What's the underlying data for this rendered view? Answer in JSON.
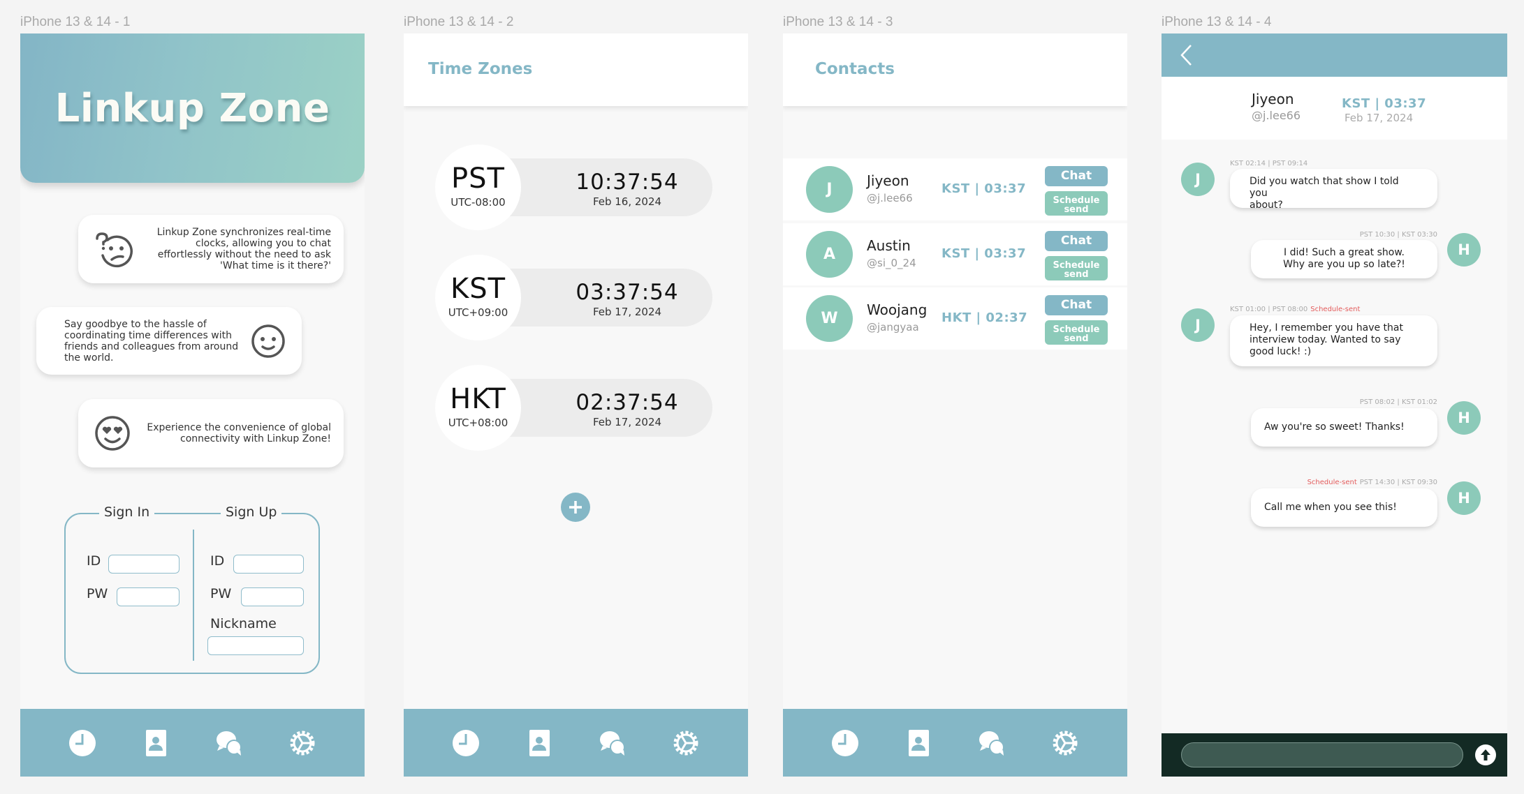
{
  "frames": [
    {
      "label": "iPhone 13 & 14 - 1"
    },
    {
      "label": "iPhone 13 & 14 - 2"
    },
    {
      "label": "iPhone 13 & 14 - 3"
    },
    {
      "label": "iPhone 13 & 14 - 4"
    }
  ],
  "nav": {
    "items": [
      {
        "icon": "clock-icon",
        "label": "Time Zones"
      },
      {
        "icon": "contact-book-icon",
        "label": "Contacts"
      },
      {
        "icon": "chat-bubbles-icon",
        "label": "Chats"
      },
      {
        "icon": "gear-icon",
        "label": "Settings"
      }
    ],
    "color": "#84b7c6"
  },
  "welcome": {
    "app_title": "Linkup Zone",
    "cards": [
      {
        "icon": "confused-face-icon",
        "text": "Linkup Zone synchronizes real-time clocks, allowing you to chat effortlessly without the need to ask 'What time is it there?'"
      },
      {
        "icon": "smiley-face-icon",
        "text": "Say goodbye to the hassle of coordinating time differences with friends and colleagues from around the world."
      },
      {
        "icon": "heart-eyes-face-icon",
        "text": "Experience the convenience of global connectivity with Linkup Zone!"
      }
    ],
    "sign_in": {
      "title": "Sign In",
      "id_label": "ID",
      "pw_label": "PW",
      "id_value": "",
      "pw_value": ""
    },
    "sign_up": {
      "title": "Sign Up",
      "id_label": "ID",
      "pw_label": "PW",
      "nickname_label": "Nickname",
      "id_value": "",
      "pw_value": "",
      "nickname_value": ""
    }
  },
  "timezones": {
    "title": "Time Zones",
    "clocks": [
      {
        "abbr": "PST",
        "offset": "UTC-08:00",
        "time": "10:37:54",
        "date": "Feb 16, 2024"
      },
      {
        "abbr": "KST",
        "offset": "UTC+09:00",
        "time": "03:37:54",
        "date": "Feb 17, 2024"
      },
      {
        "abbr": "HKT",
        "offset": "UTC+08:00",
        "time": "02:37:54",
        "date": "Feb 17, 2024"
      }
    ],
    "add_icon": "plus-icon"
  },
  "contacts": {
    "title": "Contacts",
    "chat_label": "Chat",
    "schedule_label_1": "Schedule",
    "schedule_label_2": "send",
    "list": [
      {
        "initial": "J",
        "name": "Jiyeon",
        "handle": "@j.lee66",
        "tz": "KST | 03:37"
      },
      {
        "initial": "A",
        "name": "Austin",
        "handle": "@si_0_24",
        "tz": "KST | 03:37"
      },
      {
        "initial": "W",
        "name": "Woojang",
        "handle": "@jangyaa",
        "tz": "HKT | 02:37"
      }
    ]
  },
  "chat": {
    "contact": {
      "name": "Jiyeon",
      "handle": "@j.lee66",
      "tz": "KST | 03:37",
      "date": "Feb 17, 2024"
    },
    "messages": [
      {
        "from": "J",
        "side": "left",
        "meta": "KST 02:14 | PST 09:14",
        "scheduled": "",
        "line1": "Did you watch that show I told you",
        "line2": "about?",
        "line3": ""
      },
      {
        "from": "H",
        "side": "right",
        "meta": "PST 10:30 | KST 03:30",
        "scheduled": "",
        "line1": "I did! Such a great show.",
        "line2": "Why are you up so late?!",
        "line3": ""
      },
      {
        "from": "J",
        "side": "left",
        "meta": "KST 01:00 | PST 08:00",
        "scheduled": "Schedule-sent",
        "line1": "Hey, I remember you have that",
        "line2": "interview today. Wanted to say",
        "line3": "good luck! :)"
      },
      {
        "from": "H",
        "side": "right",
        "meta": "PST 08:02 | KST 01:02",
        "scheduled": "",
        "line1": "Aw you're so sweet! Thanks!",
        "line2": "",
        "line3": ""
      },
      {
        "from": "H",
        "side": "right",
        "meta": "PST 14:30 | KST 09:30",
        "scheduled": "Schedule-sent",
        "line1": "Call me when you see this!",
        "line2": "",
        "line3": ""
      }
    ],
    "input_value": "",
    "input_placeholder": "",
    "scheduled_color": "#e35b5b"
  }
}
